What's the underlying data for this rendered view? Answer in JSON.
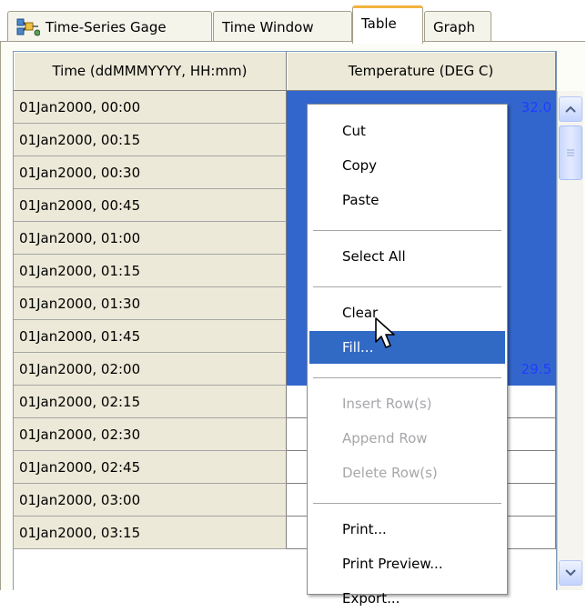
{
  "tabs": [
    {
      "label": "Time-Series Gage",
      "icon": "gage-icon",
      "active": false
    },
    {
      "label": "Time Window",
      "active": false
    },
    {
      "label": "Table",
      "active": true
    },
    {
      "label": "Graph",
      "active": false
    }
  ],
  "table": {
    "columns": [
      "Time (ddMMMYYYY, HH:mm)",
      "Temperature (DEG C)"
    ],
    "rows": [
      {
        "time": "01Jan2000, 00:00",
        "temp": "32.0",
        "selected": true
      },
      {
        "time": "01Jan2000, 00:15",
        "temp": "",
        "selected": true
      },
      {
        "time": "01Jan2000, 00:30",
        "temp": "",
        "selected": true
      },
      {
        "time": "01Jan2000, 00:45",
        "temp": "",
        "selected": true
      },
      {
        "time": "01Jan2000, 01:00",
        "temp": "",
        "selected": true
      },
      {
        "time": "01Jan2000, 01:15",
        "temp": "",
        "selected": true
      },
      {
        "time": "01Jan2000, 01:30",
        "temp": "",
        "selected": true
      },
      {
        "time": "01Jan2000, 01:45",
        "temp": "",
        "selected": true
      },
      {
        "time": "01Jan2000, 02:00",
        "temp": "29.5",
        "selected": true
      },
      {
        "time": "01Jan2000, 02:15",
        "temp": "",
        "selected": false
      },
      {
        "time": "01Jan2000, 02:30",
        "temp": "",
        "selected": false
      },
      {
        "time": "01Jan2000, 02:45",
        "temp": "",
        "selected": false
      },
      {
        "time": "01Jan2000, 03:00",
        "temp": "",
        "selected": false
      },
      {
        "time": "01Jan2000, 03:15",
        "temp": "",
        "selected": false
      }
    ]
  },
  "context_menu": {
    "items": [
      {
        "label": "Cut",
        "enabled": true
      },
      {
        "label": "Copy",
        "enabled": true
      },
      {
        "label": "Paste",
        "enabled": true
      },
      {
        "separator": true
      },
      {
        "label": "Select All",
        "enabled": true
      },
      {
        "separator": true
      },
      {
        "label": "Clear",
        "enabled": true
      },
      {
        "label": "Fill...",
        "enabled": true,
        "highlighted": true
      },
      {
        "separator": true
      },
      {
        "label": "Insert Row(s)",
        "enabled": false
      },
      {
        "label": "Append Row",
        "enabled": false
      },
      {
        "label": "Delete Row(s)",
        "enabled": false
      },
      {
        "separator": true
      },
      {
        "label": "Print...",
        "enabled": true
      },
      {
        "label": "Print Preview...",
        "enabled": true
      },
      {
        "label": "Export...",
        "enabled": true
      }
    ]
  },
  "colors": {
    "selection": "#3366cc",
    "menu_highlight": "#316ac5",
    "value_text": "#1f3dff",
    "active_tab_accent": "#f2b33d",
    "disabled_text": "#a7a6aa"
  }
}
